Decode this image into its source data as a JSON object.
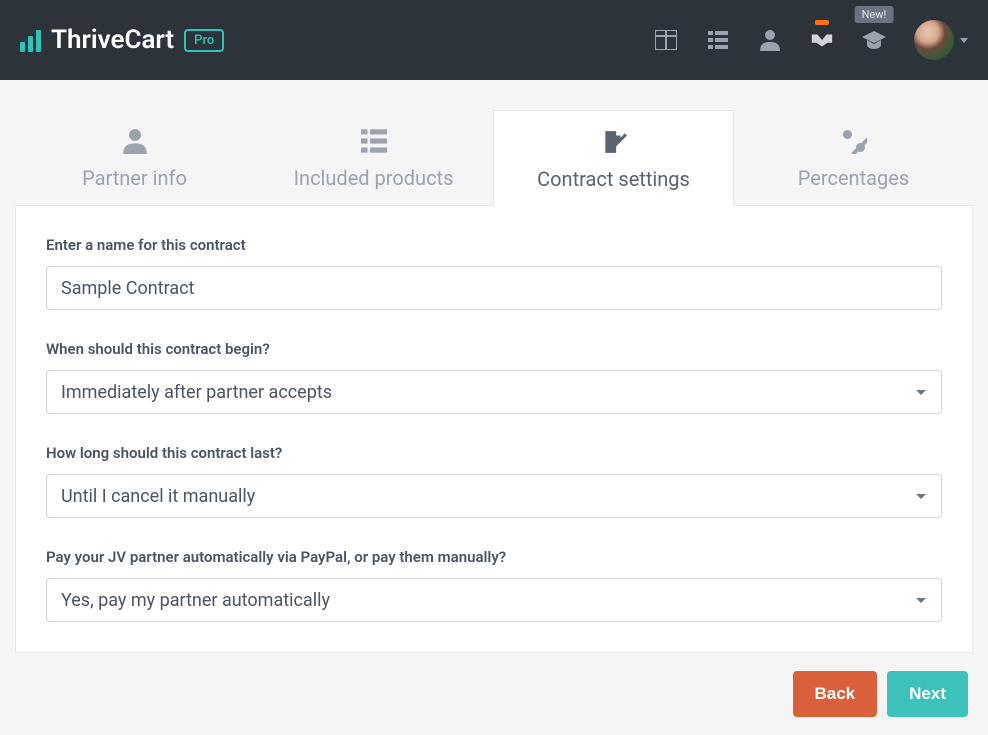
{
  "header": {
    "logo_text": "ThriveCart",
    "pro_label": "Pro",
    "new_badge": "New!",
    "icons": [
      "dashboard",
      "list",
      "user",
      "handshake",
      "graduation"
    ]
  },
  "tabs": [
    {
      "label": "Partner info",
      "active": false
    },
    {
      "label": "Included products",
      "active": false
    },
    {
      "label": "Contract settings",
      "active": true
    },
    {
      "label": "Percentages",
      "active": false
    }
  ],
  "form": {
    "name_label": "Enter a name for this contract",
    "name_value": "Sample Contract",
    "begin_label": "When should this contract begin?",
    "begin_value": "Immediately after partner accepts",
    "duration_label": "How long should this contract last?",
    "duration_value": "Until I cancel it manually",
    "pay_label": "Pay your JV partner automatically via PayPal, or pay them manually?",
    "pay_value": "Yes, pay my partner automatically"
  },
  "footer": {
    "back_label": "Back",
    "next_label": "Next"
  }
}
